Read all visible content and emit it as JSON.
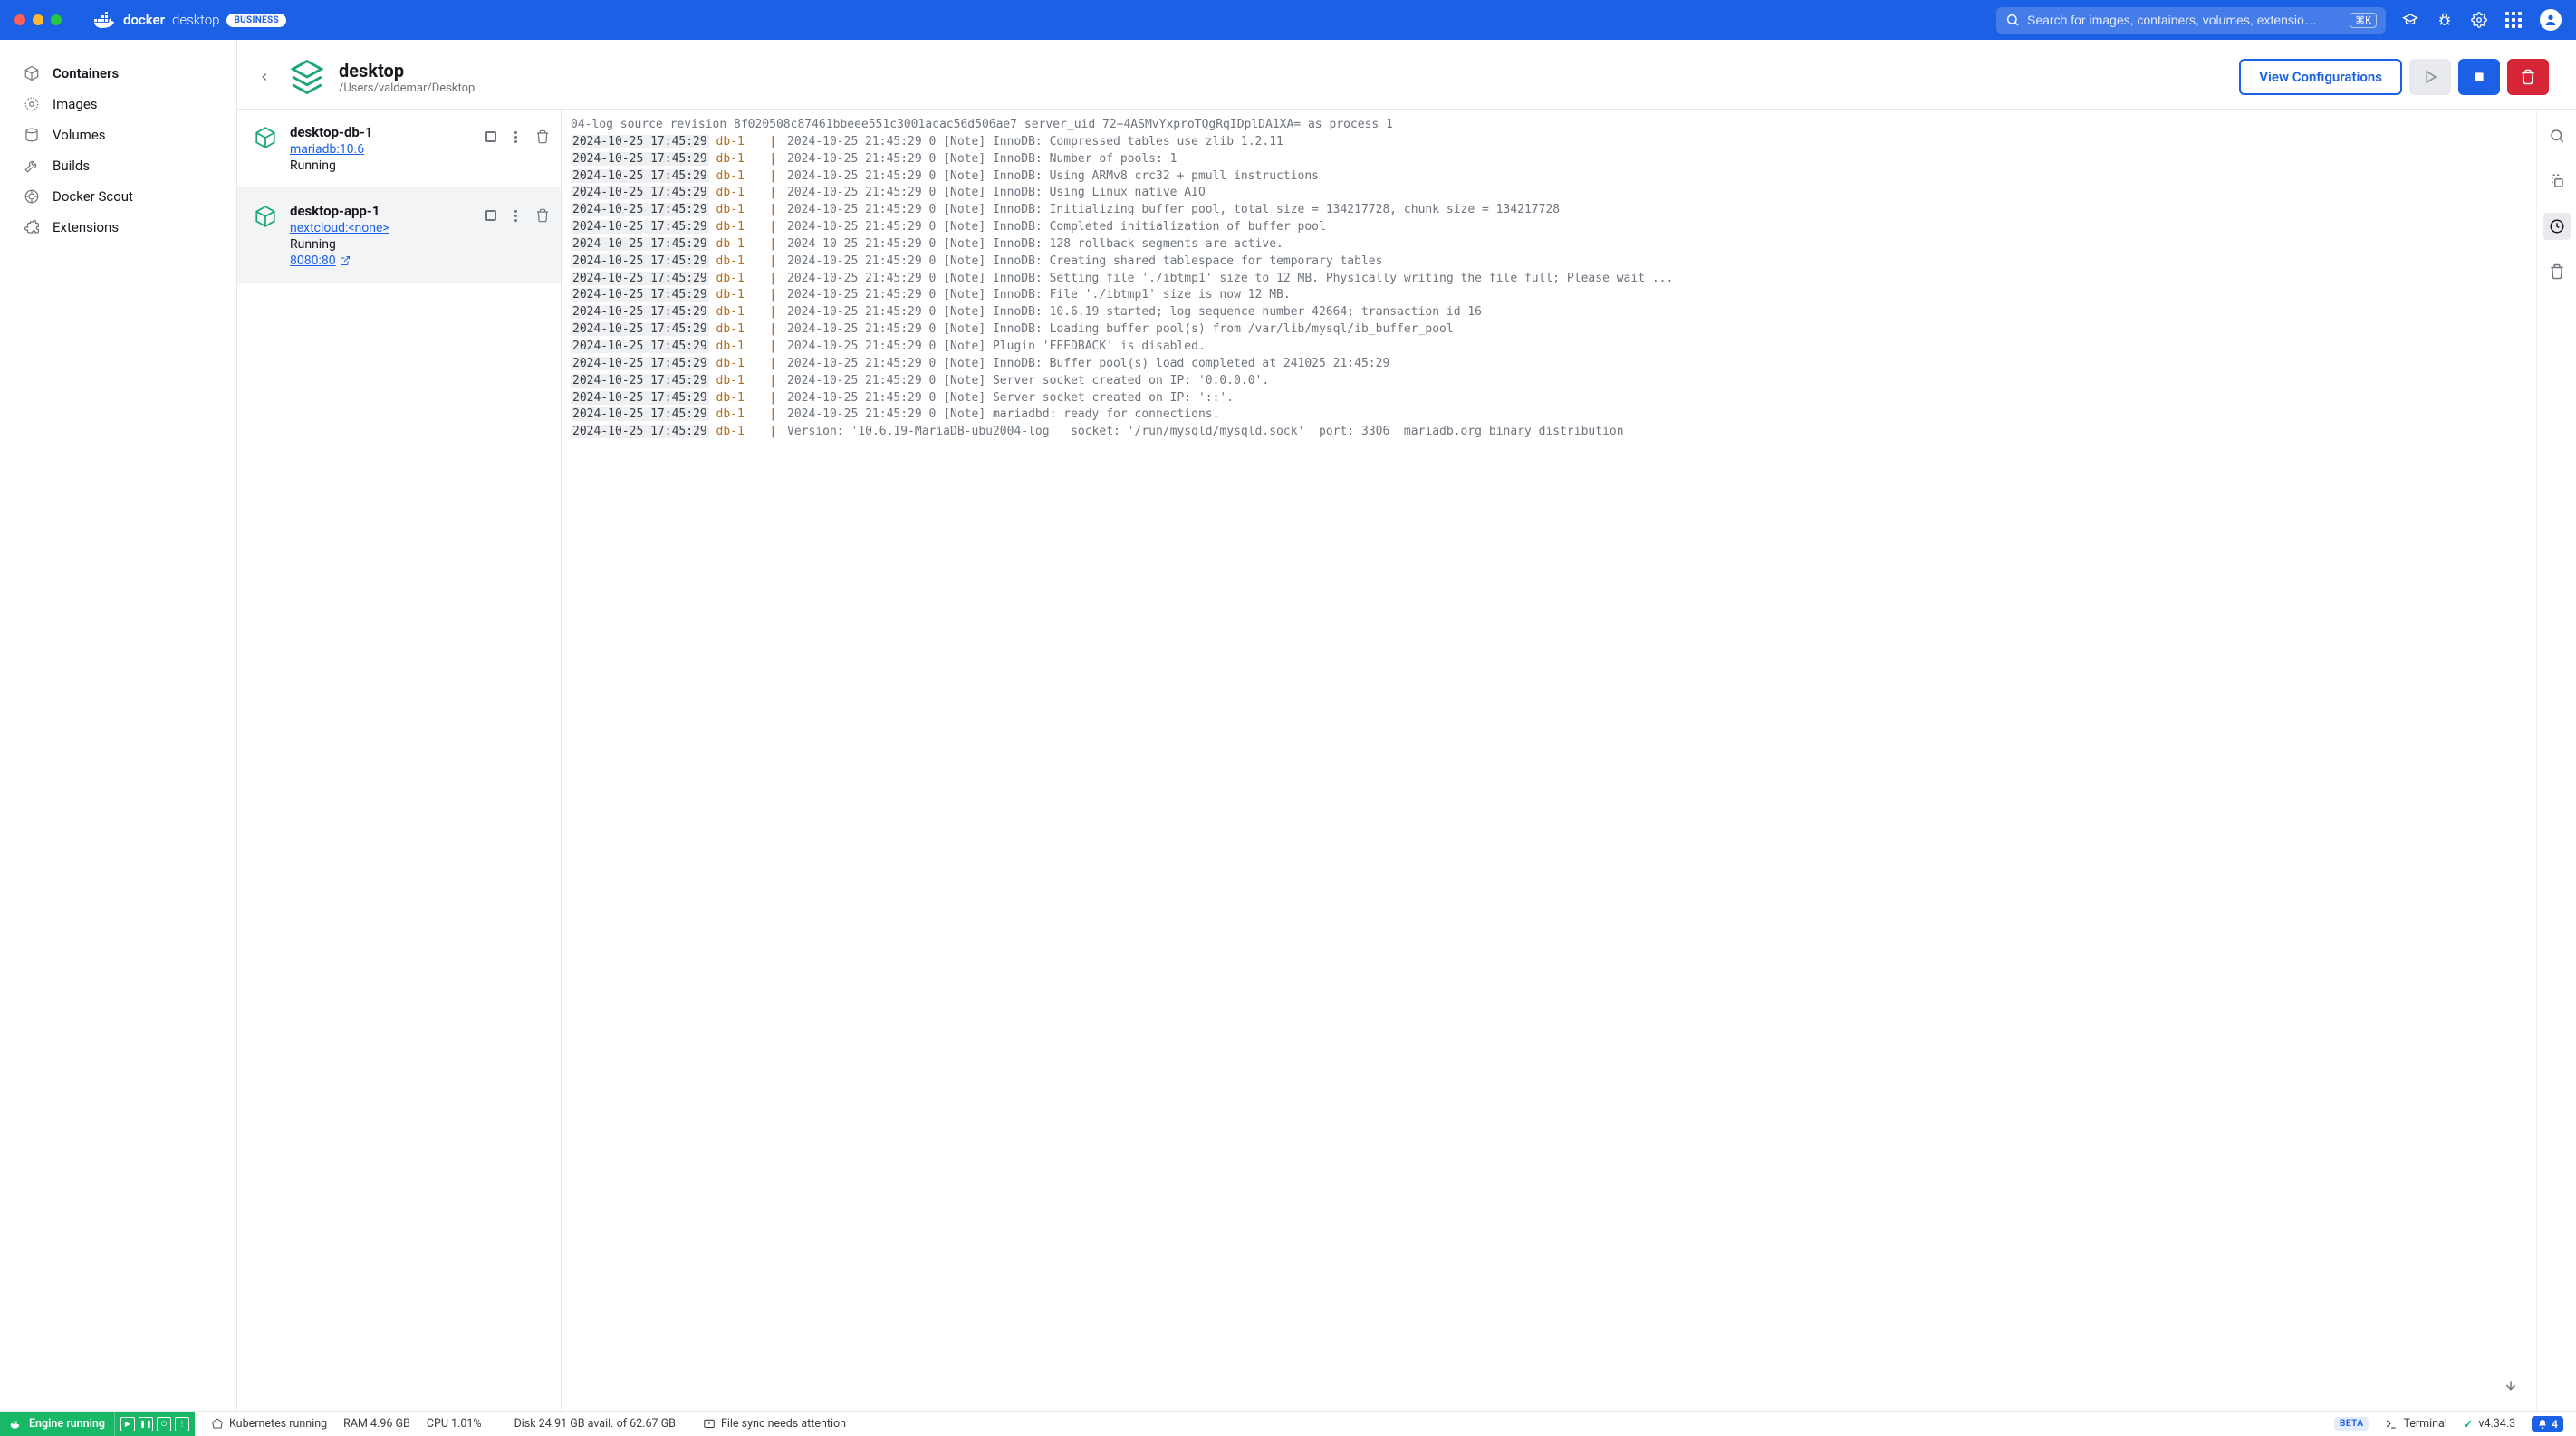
{
  "app": {
    "brand_a": "docker",
    "brand_b": "desktop",
    "business_badge": "BUSINESS"
  },
  "search": {
    "placeholder": "Search for images, containers, volumes, extensio…",
    "shortcut": "⌘K"
  },
  "sidebar": {
    "items": [
      {
        "label": "Containers"
      },
      {
        "label": "Images"
      },
      {
        "label": "Volumes"
      },
      {
        "label": "Builds"
      },
      {
        "label": "Docker Scout"
      },
      {
        "label": "Extensions"
      }
    ]
  },
  "page": {
    "title": "desktop",
    "subtitle": "/Users/valdemar/Desktop",
    "view_config": "View Configurations"
  },
  "containers": [
    {
      "name": "desktop-db-1",
      "image": "mariadb:10.6",
      "status": "Running",
      "port": null
    },
    {
      "name": "desktop-app-1",
      "image": "nextcloud:<none>",
      "status": "Running",
      "port": "8080:80"
    }
  ],
  "logs_header": "04-log source revision 8f020508c87461bbeee551c3001acac56d506ae7 server_uid 72+4ASMvYxproTQgRqIDplDA1XA= as process 1",
  "logs": [
    {
      "ts": "2024-10-25 17:45:29",
      "src": "db-1",
      "msg": "2024-10-25 21:45:29 0 [Note] InnoDB: Compressed tables use zlib 1.2.11"
    },
    {
      "ts": "2024-10-25 17:45:29",
      "src": "db-1",
      "msg": "2024-10-25 21:45:29 0 [Note] InnoDB: Number of pools: 1"
    },
    {
      "ts": "2024-10-25 17:45:29",
      "src": "db-1",
      "msg": "2024-10-25 21:45:29 0 [Note] InnoDB: Using ARMv8 crc32 + pmull instructions"
    },
    {
      "ts": "2024-10-25 17:45:29",
      "src": "db-1",
      "msg": "2024-10-25 21:45:29 0 [Note] InnoDB: Using Linux native AIO"
    },
    {
      "ts": "2024-10-25 17:45:29",
      "src": "db-1",
      "msg": "2024-10-25 21:45:29 0 [Note] InnoDB: Initializing buffer pool, total size = 134217728, chunk size = 134217728"
    },
    {
      "ts": "2024-10-25 17:45:29",
      "src": "db-1",
      "msg": "2024-10-25 21:45:29 0 [Note] InnoDB: Completed initialization of buffer pool"
    },
    {
      "ts": "2024-10-25 17:45:29",
      "src": "db-1",
      "msg": "2024-10-25 21:45:29 0 [Note] InnoDB: 128 rollback segments are active."
    },
    {
      "ts": "2024-10-25 17:45:29",
      "src": "db-1",
      "msg": "2024-10-25 21:45:29 0 [Note] InnoDB: Creating shared tablespace for temporary tables"
    },
    {
      "ts": "2024-10-25 17:45:29",
      "src": "db-1",
      "msg": "2024-10-25 21:45:29 0 [Note] InnoDB: Setting file './ibtmp1' size to 12 MB. Physically writing the file full; Please wait ..."
    },
    {
      "ts": "2024-10-25 17:45:29",
      "src": "db-1",
      "msg": "2024-10-25 21:45:29 0 [Note] InnoDB: File './ibtmp1' size is now 12 MB."
    },
    {
      "ts": "2024-10-25 17:45:29",
      "src": "db-1",
      "msg": "2024-10-25 21:45:29 0 [Note] InnoDB: 10.6.19 started; log sequence number 42664; transaction id 16"
    },
    {
      "ts": "2024-10-25 17:45:29",
      "src": "db-1",
      "msg": "2024-10-25 21:45:29 0 [Note] InnoDB: Loading buffer pool(s) from /var/lib/mysql/ib_buffer_pool"
    },
    {
      "ts": "2024-10-25 17:45:29",
      "src": "db-1",
      "msg": "2024-10-25 21:45:29 0 [Note] Plugin 'FEEDBACK' is disabled."
    },
    {
      "ts": "2024-10-25 17:45:29",
      "src": "db-1",
      "msg": "2024-10-25 21:45:29 0 [Note] InnoDB: Buffer pool(s) load completed at 241025 21:45:29"
    },
    {
      "ts": "2024-10-25 17:45:29",
      "src": "db-1",
      "msg": "2024-10-25 21:45:29 0 [Note] Server socket created on IP: '0.0.0.0'."
    },
    {
      "ts": "2024-10-25 17:45:29",
      "src": "db-1",
      "msg": "2024-10-25 21:45:29 0 [Note] Server socket created on IP: '::'."
    },
    {
      "ts": "2024-10-25 17:45:29",
      "src": "db-1",
      "msg": "2024-10-25 21:45:29 0 [Note] mariadbd: ready for connections."
    },
    {
      "ts": "2024-10-25 17:45:29",
      "src": "db-1",
      "msg": "Version: '10.6.19-MariaDB-ubu2004-log'  socket: '/run/mysqld/mysqld.sock'  port: 3306  mariadb.org binary distribution"
    }
  ],
  "status": {
    "engine": "Engine running",
    "k8s": "Kubernetes running",
    "ram": "RAM 4.96 GB",
    "cpu": "CPU 1.01%",
    "disk": "Disk 24.91 GB avail. of 62.67 GB",
    "filesync": "File sync needs attention",
    "beta": "BETA",
    "terminal": "Terminal",
    "version": "v4.34.3",
    "notif": "4"
  }
}
